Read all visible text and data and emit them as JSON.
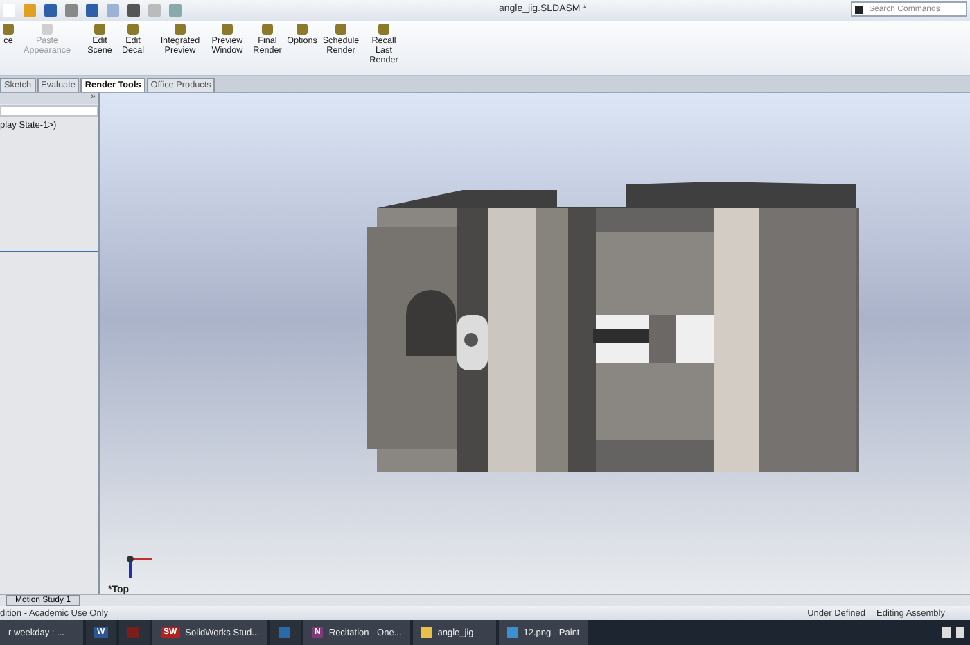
{
  "window": {
    "title": "angle_jig.SLDASM *",
    "search": {
      "placeholder": "Search Commands"
    }
  },
  "ribbon": [
    {
      "label": "ce",
      "disabled": false
    },
    {
      "label": "Paste Appearance",
      "disabled": true
    },
    {
      "label": "Edit Scene",
      "disabled": false
    },
    {
      "label": "Edit Decal",
      "disabled": false
    },
    {
      "label": "Integrated Preview",
      "disabled": false
    },
    {
      "label": "Preview Window",
      "disabled": false
    },
    {
      "label": "Final Render",
      "disabled": false
    },
    {
      "label": "Options",
      "disabled": false
    },
    {
      "label": "Schedule Render",
      "disabled": false
    },
    {
      "label": "Recall Last Render",
      "disabled": false
    }
  ],
  "tabs": [
    {
      "label": "Sketch",
      "selected": false
    },
    {
      "label": "Evaluate",
      "selected": false
    },
    {
      "label": "Render Tools",
      "selected": true
    },
    {
      "label": "Office Products",
      "selected": false
    }
  ],
  "tree": {
    "collapse_glyph": "»",
    "items": [
      "play State-1>)"
    ]
  },
  "viewport": {
    "view_label": "*Top"
  },
  "bottom_tabs": [
    {
      "label": "Motion Study 1",
      "selected": true
    }
  ],
  "status_bar": {
    "left": "dition - Academic Use Only",
    "items": [
      "Under Defined",
      "Editing Assembly"
    ]
  },
  "taskbar": [
    {
      "kind": "text",
      "label": "r weekday : ..."
    },
    {
      "kind": "icon",
      "badge": "W",
      "color": "#2b5797"
    },
    {
      "kind": "icon",
      "color": "#7a1e1e"
    },
    {
      "kind": "text",
      "label": "SolidWorks Stud...",
      "color": "#b32020",
      "badge": "SW"
    },
    {
      "kind": "icon",
      "color": "#2a6aa8"
    },
    {
      "kind": "text",
      "label": "Recitation - One...",
      "color": "#80397b",
      "badge": "N"
    },
    {
      "kind": "text",
      "label": "angle_jig",
      "color": "#e8c04a"
    },
    {
      "kind": "text",
      "label": "12.png - Paint",
      "color": "#3d8fd1"
    }
  ]
}
